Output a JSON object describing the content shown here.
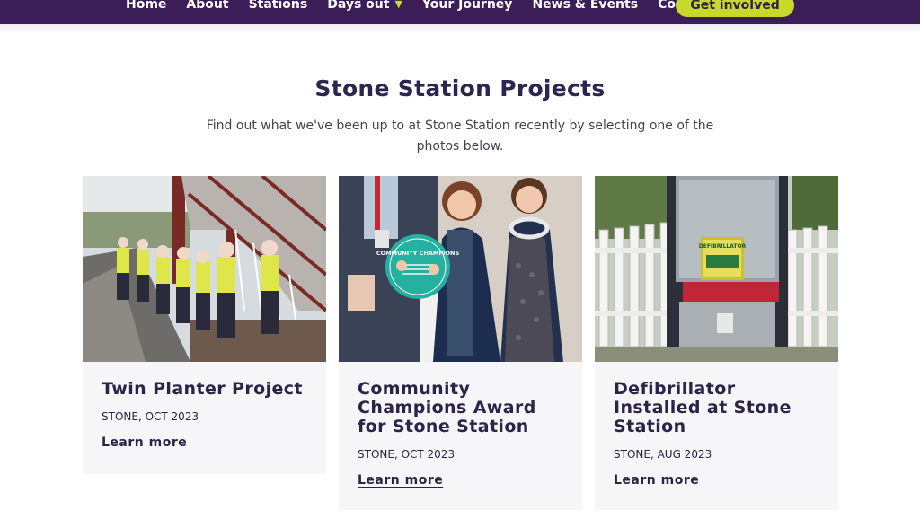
{
  "nav": {
    "items": [
      "Home",
      "About",
      "Stations",
      "Days out",
      "Your Journey",
      "News & Events",
      "Contact us"
    ],
    "dropdown_icon": "chevron-down-icon",
    "cta_label": "Get involved"
  },
  "section": {
    "title": "Stone Station Projects",
    "intro": "Find out what we've been up to at Stone Station recently by selecting one of the photos below."
  },
  "cards": [
    {
      "title": "Twin Planter Project",
      "meta": "STONE, OCT 2023",
      "link": "Learn more"
    },
    {
      "title": "Community Champions Award for Stone Station",
      "meta": "STONE, OCT 2023",
      "link": "Learn more",
      "award_text": "COMMUNITY CHAMPIONS"
    },
    {
      "title": "Defibrillator Installed at Stone Station",
      "meta": "STONE, AUG 2023",
      "link": "Learn more",
      "sign_text": "DEFIBRILLATOR"
    }
  ],
  "colors": {
    "nav_bg": "#3b1d58",
    "accent": "#c9d82c",
    "heading": "#2d2450",
    "card_bg": "#f6f5f8"
  }
}
